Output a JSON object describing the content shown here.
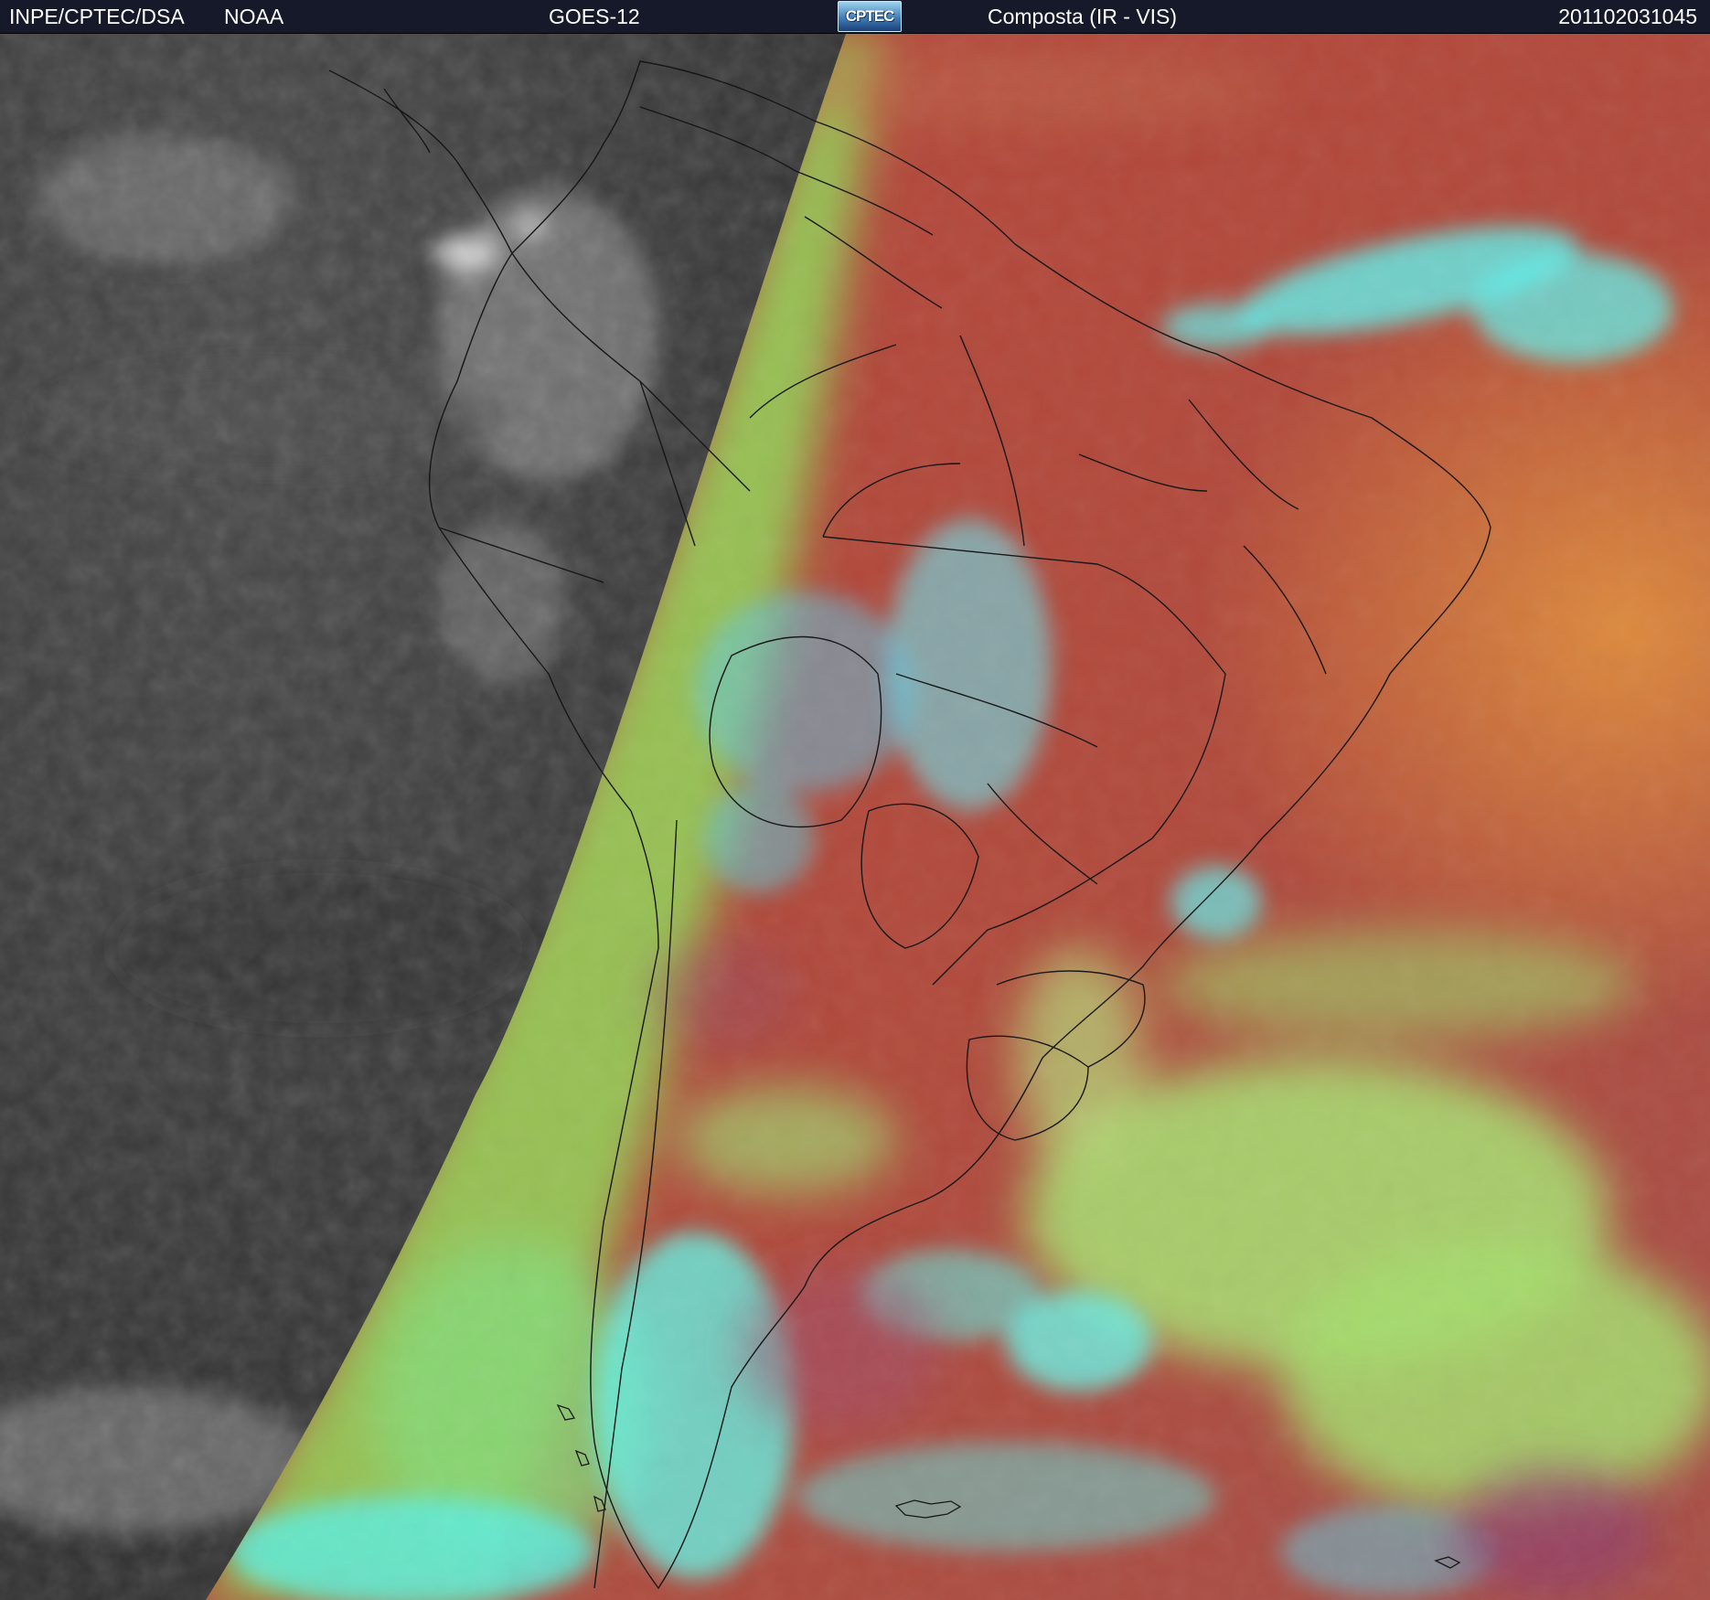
{
  "header": {
    "source": "INPE/CPTEC/DSA",
    "agency": "NOAA",
    "satellite": "GOES-12",
    "logo_text": "CPTEC",
    "product": "Composta (IR - VIS)",
    "timestamp": "201102031045"
  },
  "colors": {
    "header_bg": "#16192a",
    "night_gray": "#3a3a3a",
    "land_red": "#b44a3c",
    "cloud_cyan": "#5ff0e6",
    "cloud_green": "#9be86a",
    "terminator_green": "#8fe85e"
  }
}
